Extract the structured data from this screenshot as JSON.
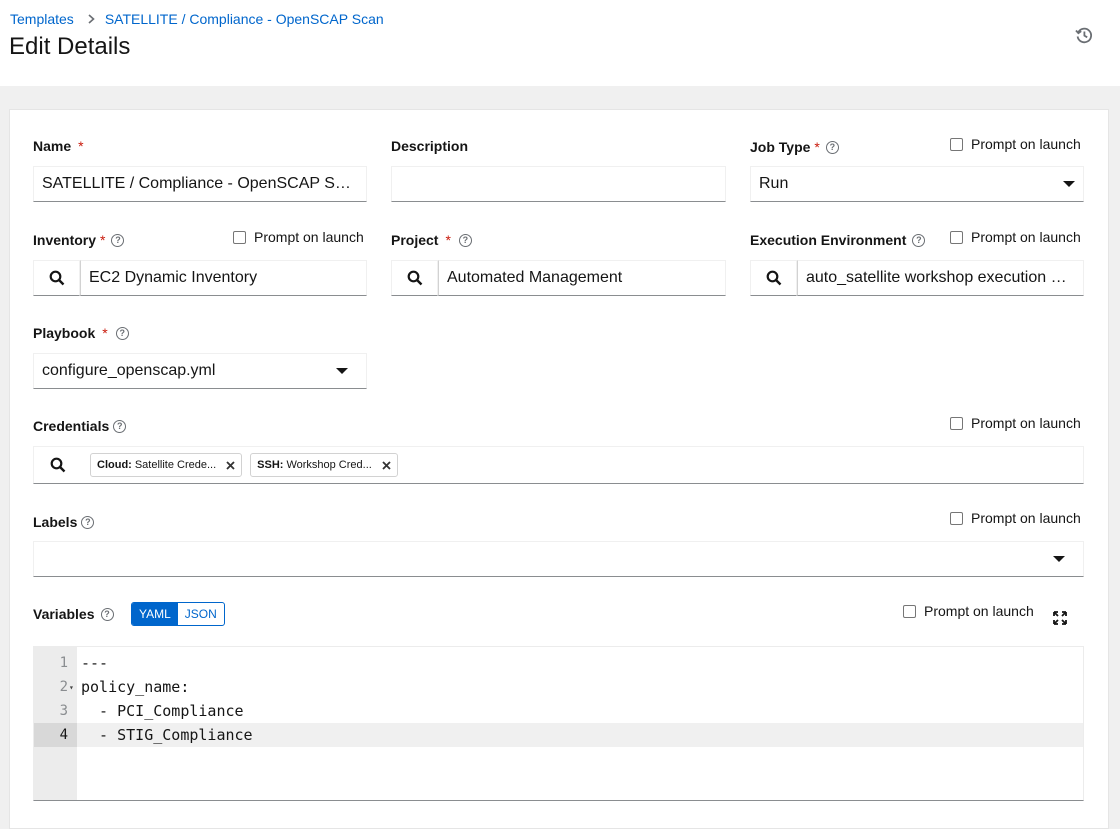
{
  "breadcrumb": {
    "parent": "Templates",
    "current": "SATELLITE / Compliance - OpenSCAP Scan"
  },
  "page_title": "Edit Details",
  "prompt_label": "Prompt on launch",
  "form": {
    "name": {
      "label": "Name",
      "value": "SATELLITE / Compliance - OpenSCAP Scan"
    },
    "description": {
      "label": "Description",
      "value": ""
    },
    "job_type": {
      "label": "Job Type",
      "value": "Run"
    },
    "inventory": {
      "label": "Inventory",
      "value": "EC2 Dynamic Inventory"
    },
    "project": {
      "label": "Project",
      "value": "Automated Management"
    },
    "execution_environment": {
      "label": "Execution Environment",
      "value": "auto_satellite workshop execution environment"
    },
    "playbook": {
      "label": "Playbook",
      "value": "configure_openscap.yml"
    },
    "credentials": {
      "label": "Credentials",
      "chips": [
        {
          "type": "Cloud:",
          "name": "Satellite Crede..."
        },
        {
          "type": "SSH:",
          "name": "Workshop Cred..."
        }
      ]
    },
    "labels": {
      "label": "Labels",
      "value": ""
    },
    "variables": {
      "label": "Variables",
      "modes": [
        "YAML",
        "JSON"
      ],
      "active_mode": "YAML",
      "lines": [
        "---",
        "policy_name:",
        "  - PCI_Compliance",
        "  - STIG_Compliance"
      ],
      "line_numbers": [
        "1",
        "2",
        "3",
        "4"
      ]
    }
  },
  "icons": {
    "history": "history-icon",
    "search": "search-icon",
    "close": "close-icon",
    "help": "help-icon",
    "caret": "caret-down-icon",
    "expand": "expand-icon"
  },
  "colors": {
    "link": "#0066cc",
    "required": "#c9190b",
    "page_bg": "#f0f0f0"
  }
}
